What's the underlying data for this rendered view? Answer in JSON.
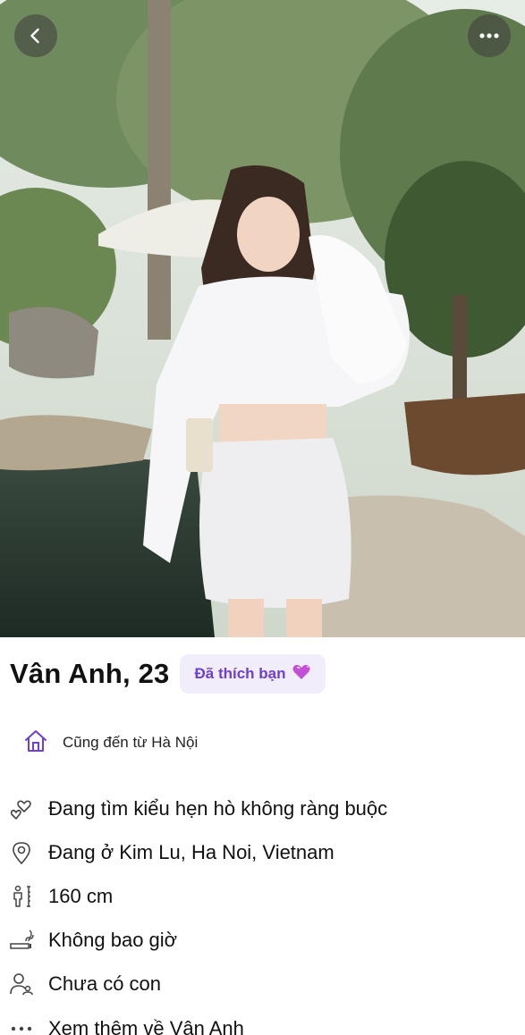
{
  "profile": {
    "name_age": "Vân Anh, 23",
    "liked_badge": "Đã thích bạn",
    "liked_badge_icon": "purple-heart-icon"
  },
  "hometown": {
    "icon": "house-icon",
    "text": "Cũng đến từ Hà Nội"
  },
  "details": [
    {
      "icon": "hearts-icon",
      "text": "Đang tìm kiểu hẹn hò không ràng buộc"
    },
    {
      "icon": "location-pin-icon",
      "text": "Đang ở Kim Lu, Ha Noi, Vietnam"
    },
    {
      "icon": "height-icon",
      "text": "160 cm"
    },
    {
      "icon": "smoking-icon",
      "text": "Không bao giờ"
    },
    {
      "icon": "children-icon",
      "text": "Chưa có con"
    },
    {
      "icon": "more-dots-icon",
      "text": "Xem thêm về Vân Anh"
    }
  ],
  "colors": {
    "accent": "#6e3fd0",
    "badge_bg": "#f1edfb"
  }
}
